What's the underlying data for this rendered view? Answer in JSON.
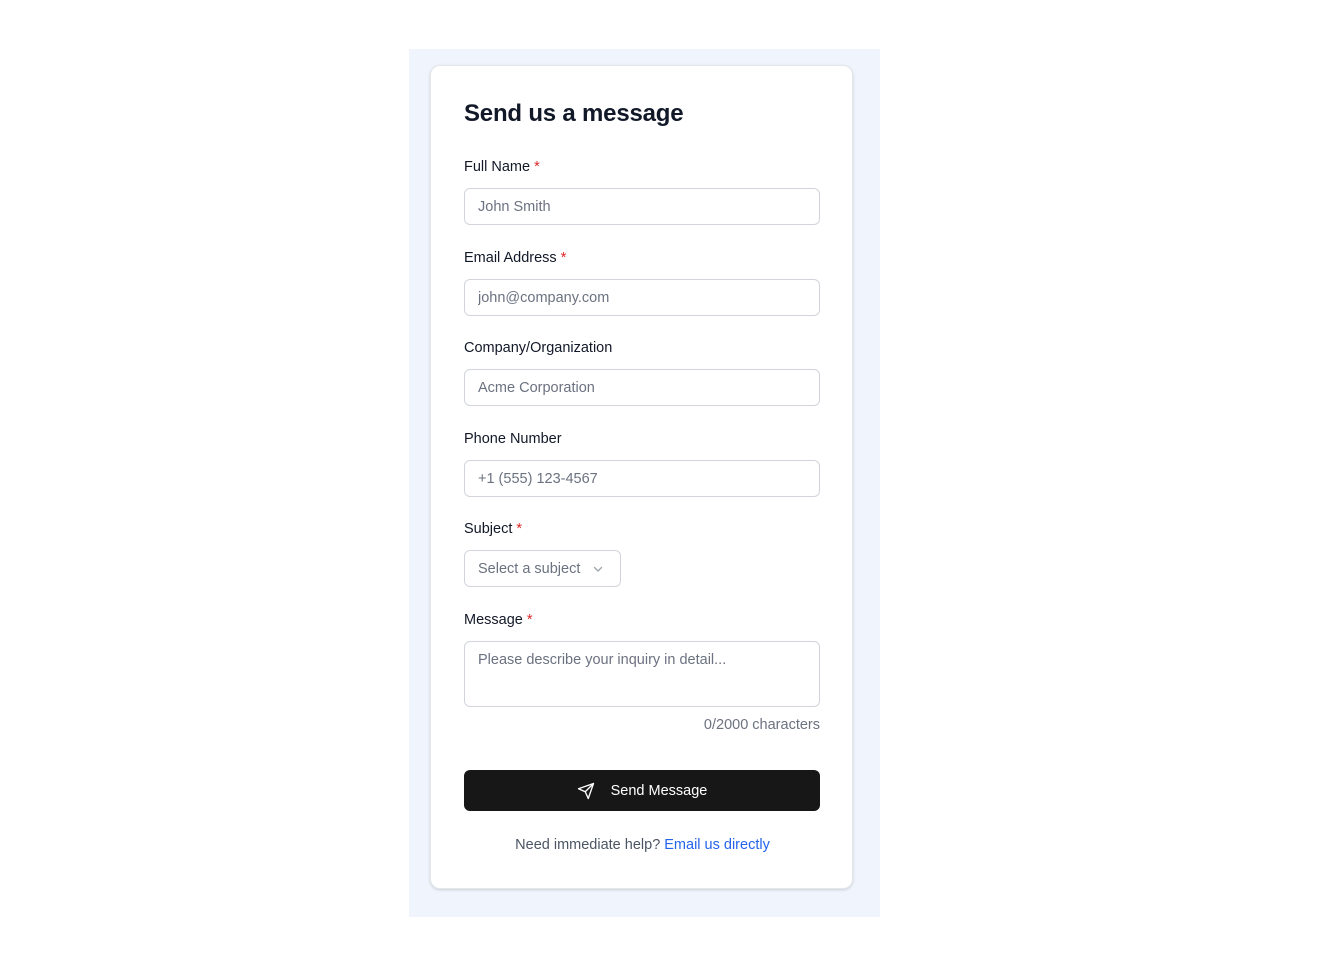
{
  "form": {
    "title": "Send us a message",
    "required_marker": "*",
    "fields": {
      "full_name": {
        "label": "Full Name",
        "placeholder": "John Smith",
        "value": ""
      },
      "email": {
        "label": "Email Address",
        "placeholder": "john@company.com",
        "value": ""
      },
      "company": {
        "label": "Company/Organization",
        "placeholder": "Acme Corporation",
        "value": ""
      },
      "phone": {
        "label": "Phone Number",
        "placeholder": "+1 (555) 123-4567",
        "value": ""
      },
      "subject": {
        "label": "Subject",
        "selected": "Select a subject"
      },
      "message": {
        "label": "Message",
        "placeholder": "Please describe your inquiry in detail...",
        "value": "",
        "counter": "0/2000 characters"
      }
    },
    "submit_label": "Send Message",
    "submit_icon": "send-icon",
    "help_text": "Need immediate help?",
    "help_link": "Email us directly"
  },
  "colors": {
    "panel_bg": "#eff4fd",
    "button_bg": "#171717",
    "required": "#dc2626",
    "link": "#2563eb"
  }
}
